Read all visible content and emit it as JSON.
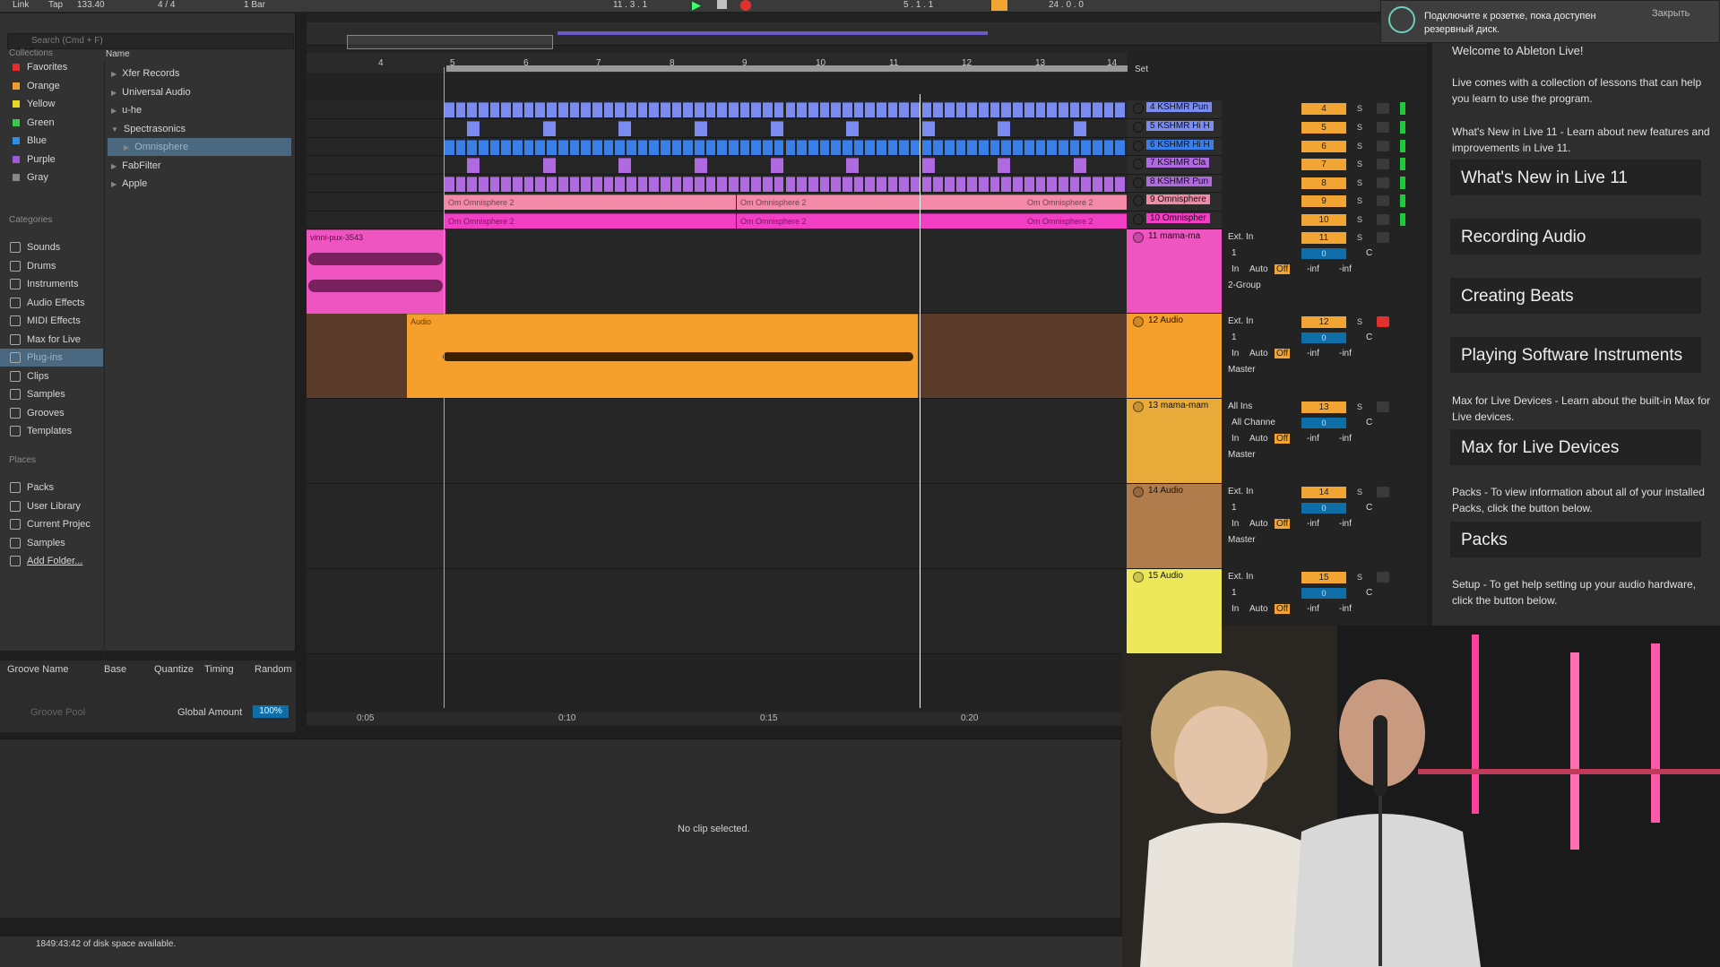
{
  "top_bar": {
    "link": "Link",
    "tap": "Tap",
    "tempo": "133.40",
    "signature": "4 / 4",
    "quantize": "1 Bar",
    "position": "11 .  3 .  1",
    "loop_start": "5 .  1 .  1",
    "loop_length": "24 .  0 .  0"
  },
  "browser": {
    "search_placeholder": "Search (Cmd + F)",
    "collections_header": "Collections",
    "collections": [
      {
        "label": "Favorites",
        "color": "#e03030"
      },
      {
        "label": "Orange",
        "color": "#f09a2a"
      },
      {
        "label": "Yellow",
        "color": "#e8d62a"
      },
      {
        "label": "Green",
        "color": "#3cc94b"
      },
      {
        "label": "Blue",
        "color": "#2c8fe0"
      },
      {
        "label": "Purple",
        "color": "#9c5ad6"
      },
      {
        "label": "Gray",
        "color": "#888888"
      }
    ],
    "categories_header": "Categories",
    "categories": [
      "Sounds",
      "Drums",
      "Instruments",
      "Audio Effects",
      "MIDI Effects",
      "Max for Live",
      "Plug-ins",
      "Clips",
      "Samples",
      "Grooves",
      "Templates"
    ],
    "places_header": "Places",
    "places": [
      "Packs",
      "User Library",
      "Current Projec",
      "Samples",
      "Add Folder..."
    ],
    "name_header": "Name",
    "tree": [
      {
        "label": "Xfer Records",
        "indent": 0
      },
      {
        "label": "Universal Audio",
        "indent": 0
      },
      {
        "label": "u-he",
        "indent": 0
      },
      {
        "label": "Spectrasonics",
        "indent": 0
      },
      {
        "label": "Omnisphere",
        "indent": 1
      },
      {
        "label": "FabFilter",
        "indent": 0
      },
      {
        "label": "Apple",
        "indent": 0
      }
    ]
  },
  "groove_pool": {
    "headers": [
      "Groove Name",
      "Base",
      "Quantize",
      "Timing",
      "Random"
    ],
    "label": "Groove Pool",
    "global_amount_label": "Global Amount",
    "global_amount": "100%"
  },
  "arrangement": {
    "bars": [
      "4",
      "5",
      "6",
      "7",
      "8",
      "9",
      "10",
      "11",
      "12",
      "13",
      "14"
    ],
    "set_label": "Set",
    "time_marks": [
      "0:05",
      "0:10",
      "0:15",
      "0:20"
    ],
    "clip_labels": {
      "omni_pink": "Om Omnisphere 2",
      "vinni": "vinni-pux-3543",
      "audio": "Audio"
    },
    "no_clip": "No clip selected."
  },
  "tracks": [
    {
      "name": "4 KSHMR Pun",
      "num": "4",
      "color": "#7a8cf0"
    },
    {
      "name": "5 KSHMR Hi H",
      "num": "5",
      "color": "#7a8cf0"
    },
    {
      "name": "6 KSHMR Hi H",
      "num": "6",
      "color": "#3a7ee8"
    },
    {
      "name": "7 KSHMR Cla",
      "num": "7",
      "color": "#b06ae0"
    },
    {
      "name": "8 KSHMR Pun",
      "num": "8",
      "color": "#b06ae0"
    },
    {
      "name": "9 Omnisphere",
      "num": "9",
      "color": "#f58aa8"
    },
    {
      "name": "10 Omnispher",
      "num": "10",
      "color": "#f23ec4"
    },
    {
      "name": "11 mama-ma",
      "num": "11",
      "color": "#ee55c0"
    },
    {
      "name": "12 Audio",
      "num": "12",
      "color": "#f5a02c"
    },
    {
      "name": "13 mama-mam",
      "num": "13",
      "color": "#e8ab3a"
    },
    {
      "name": "14 Audio",
      "num": "14",
      "color": "#b07c4c"
    },
    {
      "name": "15 Audio",
      "num": "15",
      "color": "#ece85a"
    }
  ],
  "mixer": {
    "ext_in": "Ext. In",
    "all_ins": "All Ins",
    "all_channels": "All Channe",
    "input_1": "1",
    "in": "In",
    "auto": "Auto",
    "off": "Off",
    "inf": "-inf",
    "zero": "0",
    "center": "C",
    "solo": "S",
    "group_out": "2-Group",
    "master_out": "Master"
  },
  "help": {
    "notification": "Подключите к розетке, пока доступен резервный диск.",
    "close": "Закрыть",
    "title": "Welcome to Ableton Live!",
    "intro": "Live comes with a collection of lessons that can help you learn to use the program.",
    "whats_new_desc": "What's New in Live 11 - Learn about new features and improvements in Live 11.",
    "lessons": [
      "What's New in Live 11",
      "Recording Audio",
      "Creating Beats",
      "Playing Software Instruments"
    ],
    "m4l_desc": "Max for Live Devices - Learn about the built-in Max for Live devices.",
    "m4l_btn": "Max for Live Devices",
    "packs_desc": "Packs - To view information about all of your installed Packs, click the button below.",
    "packs_btn": "Packs",
    "setup_desc": "Setup - To get help setting up your audio hardware, click the button below."
  },
  "status": {
    "disk": "1849:43:42 of disk space available."
  }
}
